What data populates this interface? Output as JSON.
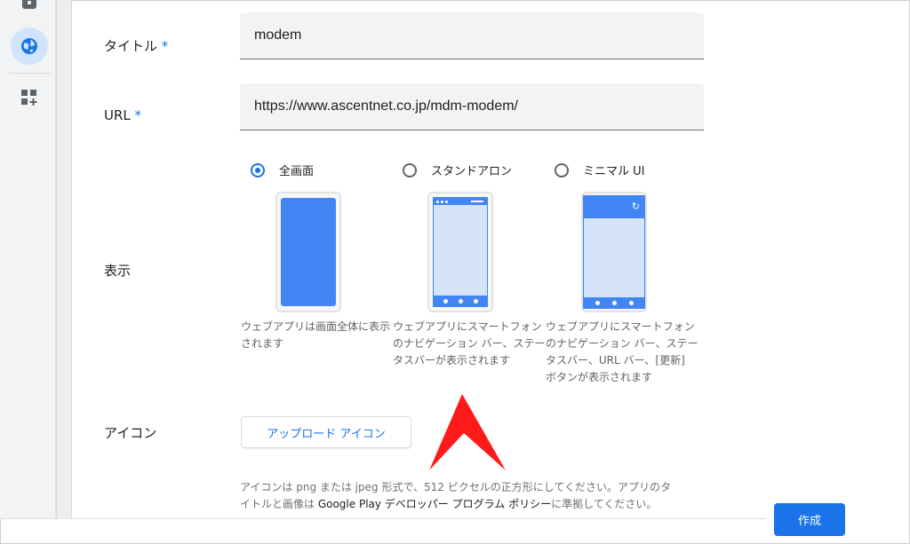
{
  "sidebar": {
    "icons": [
      "storage-icon",
      "web-icon",
      "add-app-icon"
    ]
  },
  "form": {
    "title_label": "タイトル",
    "required_mark": "*",
    "title_value": "modem",
    "url_label": "URL",
    "url_value": "https://www.ascentnet.co.jp/mdm-modem/",
    "display_label": "表示",
    "display_options": [
      {
        "label": "全画面",
        "selected": true,
        "description": "ウェブアプリは画面全体に表示されます"
      },
      {
        "label": "スタンドアロン",
        "selected": false,
        "description": "ウェブアプリにスマートフォンのナビゲーション バー、ステータスバーが表示されます"
      },
      {
        "label": "ミニマル UI",
        "selected": false,
        "description": "ウェブアプリにスマートフォンのナビゲーション バー、ステータスバー、URL バー、[更新] ボタンが表示されます"
      }
    ],
    "icon_label": "アイコン",
    "upload_button": "アップロード アイコン",
    "icon_hint_pre": "アイコンは png または jpeg 形式で、512 ピクセルの正方形にしてください。アプリのタイトルと画像は ",
    "icon_hint_policy": "Google Play デベロッパー プログラム ポリシー",
    "icon_hint_post": "に準拠してください。",
    "create_button": "作成"
  },
  "colors": {
    "accent": "#1a73e8",
    "phone_blue": "#4285f4",
    "annotation_arrow": "#ff1a1a"
  }
}
